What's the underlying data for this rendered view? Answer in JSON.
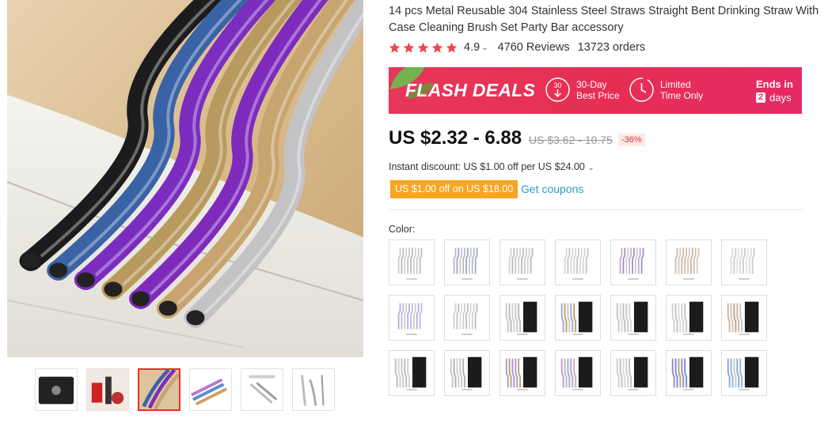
{
  "product": {
    "title": "14 pcs Metal Reusable 304 Stainless Steel Straws Straight Bent Drinking Straw With Case Cleaning Brush Set Party Bar accessory",
    "rating": "4.9",
    "reviews": "4760 Reviews",
    "orders": "13723 orders",
    "star_color": "#f0464b"
  },
  "flash_deal": {
    "title": "FLASH DEALS",
    "badge1_num": "30",
    "badge1_line1": "30-Day",
    "badge1_line2": "Best Price",
    "badge2_line1": "Limited",
    "badge2_line2": "Time Only",
    "ends_label": "Ends in",
    "days_num": "2",
    "days_label": "days",
    "bg_color": "#e62e54"
  },
  "pricing": {
    "price": "US $2.32 - 6.88",
    "old_price": "US $3.62 - 10.75",
    "discount": "-36%",
    "instant_discount": "Instant discount: US $1.00 off per US $24.00",
    "coupon_tag": "US $1.00 off on US $18.00",
    "get_coupons": "Get coupons"
  },
  "color_label": "Color:",
  "swatches": [
    {
      "kind": "straws",
      "colors": [
        "#c8c8c8",
        "#b9b9b9",
        "#d0d0d0"
      ]
    },
    {
      "kind": "straws",
      "colors": [
        "#b8b8c0",
        "#9ea3c9",
        "#c6c6c6"
      ]
    },
    {
      "kind": "straws",
      "colors": [
        "#cfcfcf",
        "#b7b7b7",
        "#c8c8c8"
      ]
    },
    {
      "kind": "straws",
      "colors": [
        "#d4d4d4",
        "#c4c4c4",
        "#d8d8d8"
      ]
    },
    {
      "kind": "straws",
      "colors": [
        "#c7a7d4",
        "#9f8cc0",
        "#c9c9c9"
      ]
    },
    {
      "kind": "straws",
      "colors": [
        "#d6b8a0",
        "#c9c9c9",
        "#d0b090"
      ]
    },
    {
      "kind": "straws",
      "colors": [
        "#d8d8d8",
        "#cacaca",
        "#e0e0e0"
      ]
    },
    {
      "kind": "straws",
      "colors": [
        "#b9a4da",
        "#b8b8e6",
        "#c9c9c9"
      ]
    },
    {
      "kind": "straws",
      "colors": [
        "#cfcfcf",
        "#bdbdbd",
        "#dadada"
      ]
    },
    {
      "kind": "pouch",
      "colors": [
        "#c8c8c8",
        "#b8b8b8",
        "#d0d0d0"
      ]
    },
    {
      "kind": "pouch",
      "colors": [
        "#9fa7d3",
        "#c0a06a",
        "#c8c8c8"
      ]
    },
    {
      "kind": "pouch",
      "colors": [
        "#c8c8c8",
        "#d6d6d6",
        "#bdbdbd"
      ]
    },
    {
      "kind": "pouch",
      "colors": [
        "#d0d0d0",
        "#c2c2c2",
        "#dadada"
      ]
    },
    {
      "kind": "pouch",
      "colors": [
        "#d6b39c",
        "#c6c6c6",
        "#c9a086"
      ]
    },
    {
      "kind": "pouch",
      "colors": [
        "#bdbdbd",
        "#d0d0d0",
        "#c7c7c7"
      ]
    },
    {
      "kind": "pouch",
      "colors": [
        "#c8c8c8",
        "#b0b0b0",
        "#d0d0d0"
      ]
    },
    {
      "kind": "pouch",
      "colors": [
        "#9da1d2",
        "#c0a06a",
        "#b48fd0"
      ]
    },
    {
      "kind": "pouch",
      "colors": [
        "#c39ad0",
        "#b7b7b7",
        "#9fa7d3"
      ]
    },
    {
      "kind": "pouch",
      "colors": [
        "#cfcfcf",
        "#c0c0c0",
        "#d8d8d8"
      ]
    },
    {
      "kind": "pouch",
      "colors": [
        "#9b86d0",
        "#6f8fd0",
        "#c0a06a"
      ]
    },
    {
      "kind": "pouch",
      "colors": [
        "#8fa6d8",
        "#8fb8d0",
        "#c9c9c9"
      ]
    }
  ],
  "thumbnails": [
    {
      "icon": "pouch-thumb"
    },
    {
      "icon": "straws-colors-thumb"
    },
    {
      "icon": "main-straws-thumb"
    },
    {
      "icon": "blue-straws-thumb"
    },
    {
      "icon": "info-thumb"
    },
    {
      "icon": "brush-thumb"
    }
  ],
  "main_image_straws": [
    "#1c1c1e",
    "#3a63a6",
    "#7a2dbf",
    "#b99a5e",
    "#7e2bbd",
    "#c8a46e",
    "#c3c3c6"
  ]
}
